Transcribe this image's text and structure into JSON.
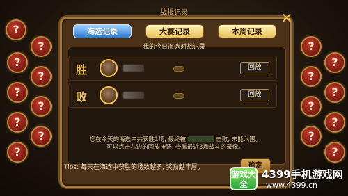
{
  "window": {
    "title_top": "战报记录"
  },
  "tabs": [
    {
      "label": "海选记录",
      "state": "active"
    },
    {
      "label": "大赛记录",
      "state": "inactive"
    },
    {
      "label": "本周记录",
      "state": "inactive"
    }
  ],
  "subheading": "我的今日海选对战记录",
  "rows": [
    {
      "result_label": "胜",
      "replay_label": "回放"
    },
    {
      "result_label": "败",
      "replay_label": "回放"
    }
  ],
  "summary": {
    "line1_prefix": "您在今天的海选中共获胜1场, 最终被",
    "line1_suffix": "击败, 未能入围。",
    "line2": "可以点击右边的回放按钮, 查看最近3场战斗的录像。"
  },
  "tips": "Tips: 每天在海选中获胜的场数越多, 奖励越丰厚。",
  "buttons": {
    "confirm_label": "确定",
    "close_icon": "close-icon"
  },
  "side_slots": {
    "symbol": "?"
  },
  "watermark": {
    "logo_text": "游戏大全",
    "title": "4399手机游戏网",
    "url": "www.4399.cn"
  },
  "colors": {
    "panel_border": "#a77b3a",
    "active_tab": "#2d7ad2",
    "inactive_tab": "#e8c35a",
    "accent_gold": "#f0c45c"
  }
}
